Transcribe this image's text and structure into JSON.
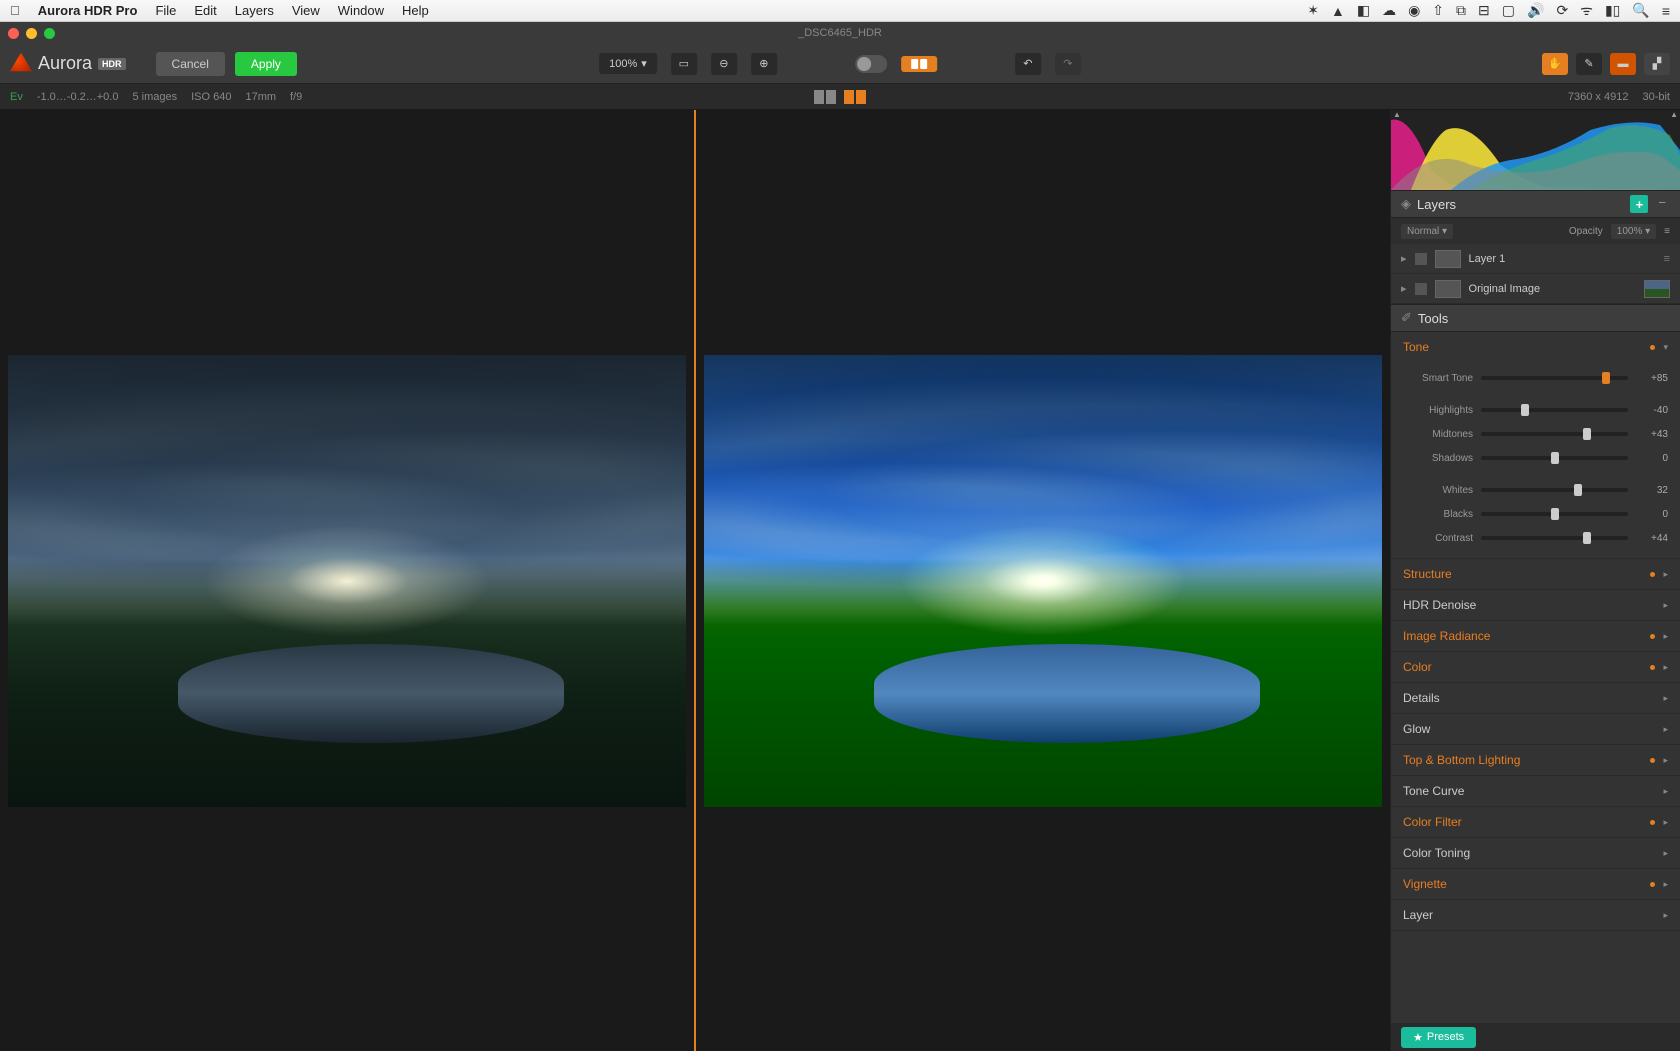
{
  "mac_menu": {
    "app": "Aurora HDR Pro",
    "items": [
      "File",
      "Edit",
      "Layers",
      "View",
      "Window",
      "Help"
    ]
  },
  "window": {
    "title": "_DSC6465_HDR"
  },
  "toolbar": {
    "logo_text": "Aurora",
    "logo_badge": "HDR",
    "cancel": "Cancel",
    "apply": "Apply",
    "zoom": "100%"
  },
  "info": {
    "ev_label": "Ev",
    "ev_values": "-1.0…-0.2…+0.0",
    "images": "5 images",
    "iso": "ISO 640",
    "focal": "17mm",
    "aperture": "f/9",
    "dimensions": "7360 x 4912",
    "bit": "30-bit"
  },
  "panel": {
    "layers_title": "Layers",
    "blend_mode": "Normal",
    "opacity_label": "Opacity",
    "opacity_value": "100%",
    "layer_items": [
      {
        "name": "Layer 1"
      },
      {
        "name": "Original Image"
      }
    ],
    "tools_title": "Tools",
    "tone": {
      "title": "Tone",
      "sliders": [
        {
          "label": "Smart Tone",
          "value": "+85",
          "pos": 85,
          "accent": true
        },
        {
          "label": "Highlights",
          "value": "-40",
          "pos": 30
        },
        {
          "label": "Midtones",
          "value": "+43",
          "pos": 72
        },
        {
          "label": "Shadows",
          "value": "0",
          "pos": 50
        },
        {
          "label": "Whites",
          "value": "32",
          "pos": 66
        },
        {
          "label": "Blacks",
          "value": "0",
          "pos": 50
        },
        {
          "label": "Contrast",
          "value": "+44",
          "pos": 72
        }
      ]
    },
    "sections": [
      {
        "title": "Structure",
        "color": "orange"
      },
      {
        "title": "HDR Denoise",
        "color": "white"
      },
      {
        "title": "Image Radiance",
        "color": "orange"
      },
      {
        "title": "Color",
        "color": "orange"
      },
      {
        "title": "Details",
        "color": "white"
      },
      {
        "title": "Glow",
        "color": "white"
      },
      {
        "title": "Top & Bottom Lighting",
        "color": "orange"
      },
      {
        "title": "Tone Curve",
        "color": "white"
      },
      {
        "title": "Color Filter",
        "color": "orange"
      },
      {
        "title": "Color Toning",
        "color": "white"
      },
      {
        "title": "Vignette",
        "color": "orange"
      },
      {
        "title": "Layer",
        "color": "white"
      }
    ],
    "presets": "Presets"
  }
}
